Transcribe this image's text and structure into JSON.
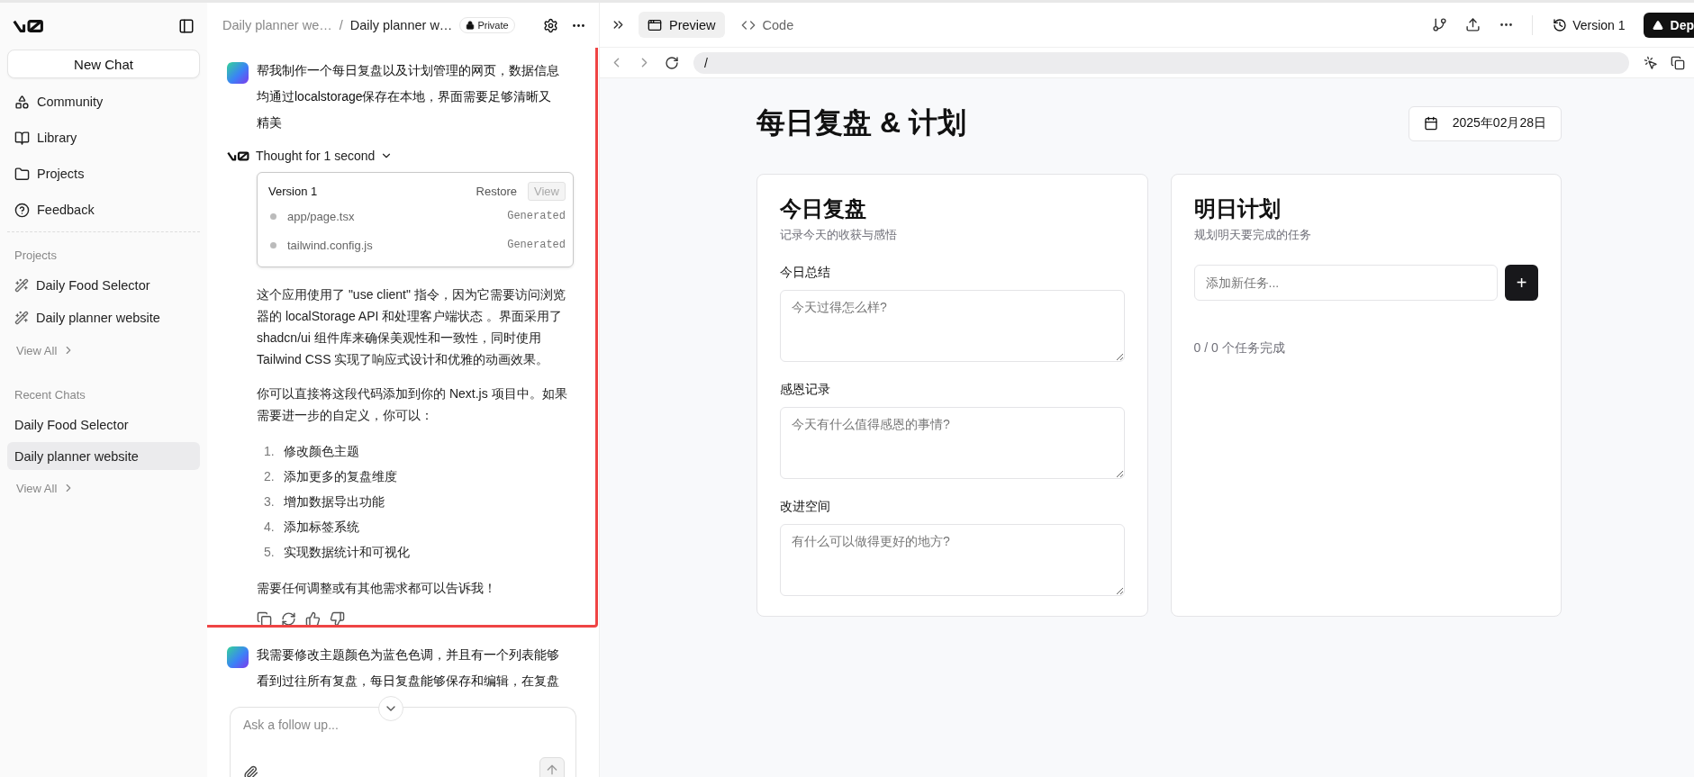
{
  "sidebar": {
    "new_chat": "New Chat",
    "nav": [
      "Community",
      "Library",
      "Projects",
      "Feedback"
    ],
    "projects": {
      "heading": "Projects",
      "items": [
        "Daily Food Selector",
        "Daily planner website"
      ],
      "view_all": "View All"
    },
    "recent": {
      "heading": "Recent Chats",
      "items": [
        {
          "label": "Daily Food Selector",
          "selected": false
        },
        {
          "label": "Daily planner website",
          "selected": true
        }
      ],
      "view_all": "View All"
    }
  },
  "chat_header": {
    "breadcrumb": [
      "Daily planner we…",
      "Daily planner w…"
    ],
    "separator": "/",
    "visibility": "Private"
  },
  "messages": [
    {
      "kind": "user",
      "text": "帮我制作一个每日复盘以及计划管理的网页，数据信息均通过localstorage保存在本地，界面需要足够清晰又精美"
    },
    {
      "kind": "assistant",
      "thought": "Thought for 1 second",
      "version": {
        "title": "Version 1",
        "restore": "Restore",
        "view": "View",
        "files": [
          {
            "name": "app/page.tsx",
            "status": "Generated"
          },
          {
            "name": "tailwind.config.js",
            "status": "Generated"
          }
        ]
      },
      "paragraphs": [
        "这个应用使用了 \"use client\" 指令，因为它需要访问浏览器的 localStorage API 和处理客户端状态 。界面采用了 shadcn/ui 组件库来确保美观性和一致性，同时使用 Tailwind CSS 实现了响应式设计和优雅的动画效果。",
        "你可以直接将这段代码添加到你的 Next.js 项目中。如果需要进一步的自定义，你可以："
      ],
      "list": [
        {
          "num": "1.",
          "text": "修改颜色主题"
        },
        {
          "num": "2.",
          "text": "添加更多的复盘维度"
        },
        {
          "num": "3.",
          "text": "增加数据导出功能"
        },
        {
          "num": "4.",
          "text": "添加标签系统"
        },
        {
          "num": "5.",
          "text": "实现数据统计和可视化"
        }
      ],
      "closing": "需要任何调整或有其他需求都可以告诉我！"
    },
    {
      "kind": "user",
      "text": "我需要修改主题颜色为蓝色色调，并且有一个列表能够看到过往所有复盘，每日复盘能够保存和编辑，在复盘"
    }
  ],
  "composer": {
    "placeholder": "Ask a follow up..."
  },
  "toolbar": {
    "tabs": [
      {
        "label": "Preview",
        "selected": true
      },
      {
        "label": "Code",
        "selected": false
      }
    ],
    "version": "Version 1",
    "deploy": "Dep"
  },
  "address": {
    "value": "/"
  },
  "preview": {
    "title": "每日复盘 & 计划",
    "date": "2025年02月28日",
    "review": {
      "title": "今日复盘",
      "subtitle": "记录今天的收获与感悟",
      "fields": [
        {
          "label": "今日总结",
          "placeholder": "今天过得怎么样?"
        },
        {
          "label": "感恩记录",
          "placeholder": "今天有什么值得感恩的事情?"
        },
        {
          "label": "改进空间",
          "placeholder": "有什么可以做得更好的地方?"
        }
      ]
    },
    "plan": {
      "title": "明日计划",
      "subtitle": "规划明天要完成的任务",
      "placeholder": "添加新任务...",
      "add": "+",
      "count": "0 / 0 个任务完成"
    }
  }
}
